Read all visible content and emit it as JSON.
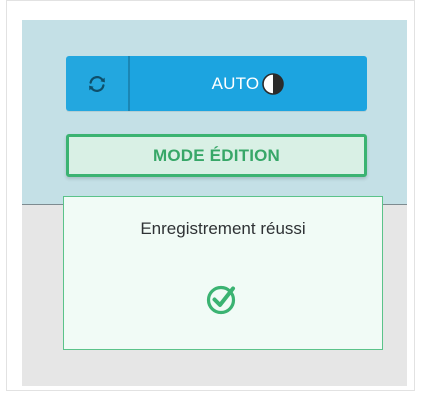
{
  "toolbar": {
    "refresh_icon": "refresh-icon",
    "auto_label": "AUTO",
    "auto_icon": "half-circle-icon",
    "accent_color": "#1ca4e0"
  },
  "mode_button": {
    "label": "MODE ÉDITION",
    "color": "#3bb372"
  },
  "toast": {
    "message": "Enregistrement réussi",
    "icon": "check-circle-icon",
    "color": "#3bb372"
  }
}
